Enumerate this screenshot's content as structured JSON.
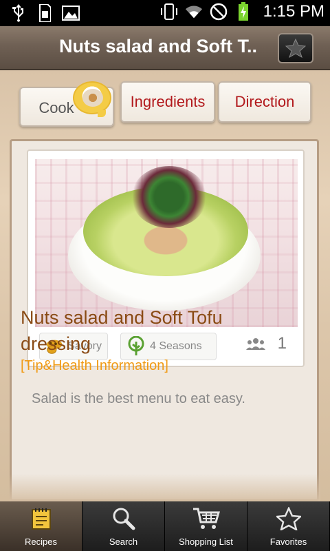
{
  "status_bar": {
    "time": "1:15 PM",
    "icons": [
      "usb-icon",
      "sd-card-icon",
      "image-icon",
      "vibrate-icon",
      "wifi-icon",
      "no-signal-icon",
      "battery-charging-icon"
    ]
  },
  "header": {
    "title": "Nuts salad and Soft T..",
    "favorite_icon": "star-icon"
  },
  "tabs": [
    {
      "label": "Cook",
      "selected": true
    },
    {
      "label": "Ingredients",
      "selected": false
    },
    {
      "label": "Direction",
      "selected": false
    }
  ],
  "recipe": {
    "taste": "Savory",
    "season": "4 Seasons",
    "servings": "1",
    "title": "Nuts salad and Soft Tofu dressing",
    "tip_header": "[Tip&Health Information]",
    "description": "Salad is the best menu to eat easy."
  },
  "bottom_nav": [
    {
      "label": "Recipes",
      "icon": "recipes-icon",
      "active": true
    },
    {
      "label": "Search",
      "icon": "search-icon",
      "active": false
    },
    {
      "label": "Shopping List",
      "icon": "cart-icon",
      "active": false
    },
    {
      "label": "Favorites",
      "icon": "star-icon",
      "active": false
    }
  ],
  "colors": {
    "title_bar": "#6f6054",
    "tab_text_red": "#b2191c",
    "recipe_title": "#8a4b15",
    "tip_orange": "#f09a14"
  }
}
